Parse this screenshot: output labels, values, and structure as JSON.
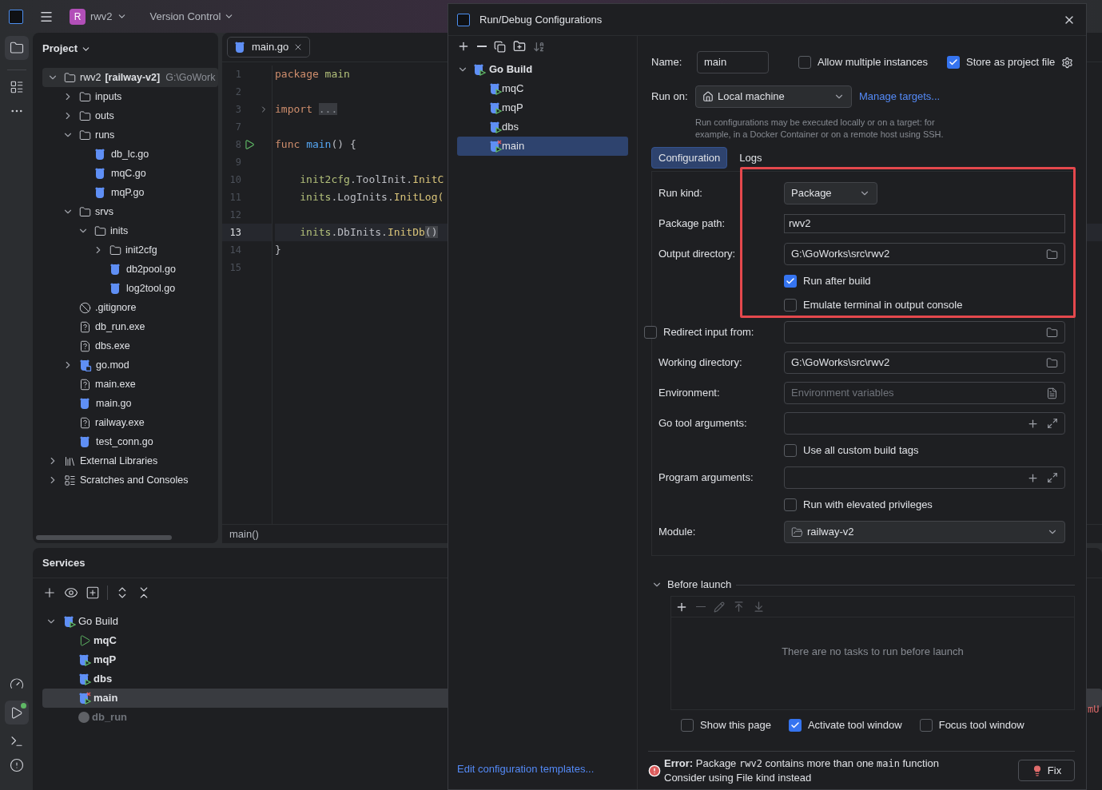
{
  "toolbar": {
    "project_badge": "R",
    "project": "rwv2",
    "vcs": "Version Control"
  },
  "project_panel": {
    "title": "Project",
    "tree": [
      {
        "label": "rwv2",
        "module": "[railway-v2]",
        "path": "G:\\GoWork",
        "kind": "folder",
        "expanded": true,
        "selected": true,
        "children": [
          {
            "label": "inputs",
            "kind": "folder",
            "expanded": false,
            "selected": false
          },
          {
            "label": "outs",
            "kind": "folder",
            "expanded": false,
            "selected": false
          },
          {
            "label": "runs",
            "kind": "folder",
            "expanded": true,
            "selected": false,
            "children": [
              {
                "label": "db_lc.go",
                "kind": "go",
                "selected": false
              },
              {
                "label": "mqC.go",
                "kind": "go",
                "selected": false
              },
              {
                "label": "mqP.go",
                "kind": "go",
                "selected": false
              }
            ]
          },
          {
            "label": "srvs",
            "kind": "folder",
            "expanded": true,
            "selected": false,
            "children": [
              {
                "label": "inits",
                "kind": "folder",
                "expanded": true,
                "selected": false,
                "children": [
                  {
                    "label": "init2cfg",
                    "kind": "folder",
                    "expanded": false,
                    "selected": false
                  },
                  {
                    "label": "db2pool.go",
                    "kind": "go",
                    "selected": false
                  },
                  {
                    "label": "log2tool.go",
                    "kind": "go",
                    "selected": false
                  }
                ]
              }
            ]
          },
          {
            "label": ".gitignore",
            "kind": "ignore",
            "selected": false
          },
          {
            "label": "db_run.exe",
            "kind": "unknown",
            "selected": false
          },
          {
            "label": "dbs.exe",
            "kind": "unknown",
            "selected": false
          },
          {
            "label": "go.mod",
            "kind": "gomod",
            "expanded": false,
            "selected": false
          },
          {
            "label": "main.exe",
            "kind": "unknown",
            "selected": false
          },
          {
            "label": "main.go",
            "kind": "go",
            "selected": false
          },
          {
            "label": "railway.exe",
            "kind": "unknown",
            "selected": false
          },
          {
            "label": "test_conn.go",
            "kind": "go",
            "selected": false
          }
        ]
      },
      {
        "label": "External Libraries",
        "kind": "libraries",
        "expanded": false,
        "selected": false
      },
      {
        "label": "Scratches and Consoles",
        "kind": "scratches",
        "expanded": false,
        "selected": false
      }
    ]
  },
  "editor": {
    "tab": "main.go",
    "breadcrumb": "main()",
    "lines": [
      {
        "number": "1",
        "current": false,
        "fold": false,
        "run": false,
        "indent": false,
        "tokens": [
          {
            "text": "package",
            "kind": "keyword"
          },
          {
            "text": "main",
            "kind": "pkg"
          }
        ]
      },
      {
        "number": "2",
        "current": false,
        "fold": false,
        "run": false
      },
      {
        "number": "3",
        "current": false,
        "fold": true,
        "run": false,
        "indent": false,
        "tokens": [
          {
            "text": "import",
            "kind": "keyword"
          },
          {
            "text": "...",
            "kind": "folded"
          }
        ]
      },
      {
        "number": "7",
        "current": false,
        "fold": false,
        "run": false
      },
      {
        "number": "8",
        "current": false,
        "fold": false,
        "run": true,
        "indent": false,
        "tokens": [
          {
            "text": "func",
            "kind": "keyword"
          },
          {
            "text": "main",
            "kind": "func"
          },
          {
            "text": "() {",
            "kind": "plain"
          }
        ]
      },
      {
        "number": "9",
        "current": false,
        "fold": false,
        "run": false
      },
      {
        "number": "10",
        "current": false,
        "fold": false,
        "run": false,
        "indent": true,
        "tokens": [
          {
            "text": "init2cfg",
            "kind": "pkg"
          },
          {
            "text": ".ToolInit.",
            "kind": "plain"
          },
          {
            "text": "InitC",
            "kind": "method"
          }
        ]
      },
      {
        "number": "11",
        "current": false,
        "fold": false,
        "run": false,
        "indent": true,
        "tokens": [
          {
            "text": "inits",
            "kind": "pkg"
          },
          {
            "text": ".LogInits.",
            "kind": "plain"
          },
          {
            "text": "InitLog(",
            "kind": "method"
          }
        ]
      },
      {
        "number": "12",
        "current": false,
        "fold": false,
        "run": false
      },
      {
        "number": "13",
        "current": true,
        "fold": false,
        "run": false,
        "indent": true,
        "tokens": [
          {
            "text": "inits",
            "kind": "pkg"
          },
          {
            "text": ".DbInits.",
            "kind": "plain"
          },
          {
            "text": "InitDb",
            "kind": "method"
          },
          {
            "text": "()",
            "kind": "match"
          }
        ]
      },
      {
        "number": "14",
        "current": false,
        "fold": false,
        "run": false,
        "indent": false,
        "tokens": [
          {
            "text": "}",
            "kind": "plain"
          }
        ]
      },
      {
        "number": "15",
        "current": false,
        "fold": false,
        "run": false
      }
    ],
    "behind_text": "mU"
  },
  "services": {
    "title": "Services",
    "tree": [
      {
        "label": "Go Build",
        "kind": "group",
        "expanded": true,
        "selected": false,
        "children": [
          {
            "label": "mqC",
            "kind": "running",
            "selected": false
          },
          {
            "label": "mqP",
            "kind": "config",
            "selected": false
          },
          {
            "label": "dbs",
            "kind": "config",
            "selected": false
          },
          {
            "label": "main",
            "kind": "error",
            "selected": true
          },
          {
            "label": "db_run",
            "kind": "stopped",
            "selected": false
          }
        ]
      }
    ]
  },
  "dialog": {
    "title": "Run/Debug Configurations",
    "tree": [
      {
        "label": "Go Build",
        "expanded": true,
        "children": [
          {
            "label": "mqC",
            "error": false,
            "selected": false
          },
          {
            "label": "mqP",
            "error": false,
            "selected": false
          },
          {
            "label": "dbs",
            "error": false,
            "selected": false
          },
          {
            "label": "main",
            "error": true,
            "selected": true
          }
        ]
      }
    ],
    "templates_link": "Edit configuration templates...",
    "name_label": "Name:",
    "name_value": "main",
    "allow_multiple": {
      "label": "Allow multiple instances",
      "checked": false
    },
    "store_project": {
      "label": "Store as project file",
      "checked": true
    },
    "run_on_label": "Run on:",
    "run_on_value": "Local machine",
    "manage_targets": "Manage targets...",
    "run_on_hint": "Run configurations may be executed locally or on a target: for example, in a Docker Container or on a remote host using SSH.",
    "tabs": [
      {
        "label": "Configuration",
        "selected": true
      },
      {
        "label": "Logs",
        "selected": false
      }
    ],
    "rows": [
      {
        "kind": "select",
        "label": "Run kind:",
        "value": "Package"
      },
      {
        "kind": "text",
        "label": "Package path:",
        "value": "rwv2"
      },
      {
        "kind": "path",
        "label": "Output directory:",
        "value": "G:\\GoWorks\\src\\rwv2"
      },
      {
        "kind": "check",
        "label": "Run after build",
        "checked": true
      },
      {
        "kind": "check",
        "label": "Emulate terminal in output console",
        "checked": false
      },
      {
        "kind": "check_path",
        "label": "Redirect input from:",
        "checked": false
      },
      {
        "kind": "path",
        "label": "Working directory:",
        "value": "G:\\GoWorks\\src\\rwv2"
      },
      {
        "kind": "env",
        "label": "Environment:",
        "placeholder": "Environment variables"
      },
      {
        "kind": "args",
        "label": "Go tool arguments:"
      },
      {
        "kind": "check",
        "label": "Use all custom build tags",
        "checked": false
      },
      {
        "kind": "args",
        "label": "Program arguments:"
      },
      {
        "kind": "check",
        "label": "Run with elevated privileges",
        "checked": false
      },
      {
        "kind": "module",
        "label": "Module:",
        "value": "railway-v2"
      }
    ],
    "before_launch": {
      "title": "Before launch",
      "expanded": true,
      "empty": "There are no tasks to run before launch",
      "options": [
        {
          "label": "Show this page",
          "checked": false
        },
        {
          "label": "Activate tool window",
          "checked": true
        },
        {
          "label": "Focus tool window",
          "checked": false
        }
      ]
    },
    "error": {
      "label": "Error:",
      "parts": [
        {
          "text": "Package ",
          "kind": "text"
        },
        {
          "text": "rwv2",
          "kind": "code"
        },
        {
          "text": " contains more than one ",
          "kind": "text"
        },
        {
          "text": "main",
          "kind": "code"
        },
        {
          "text": " function",
          "kind": "text"
        }
      ],
      "hint": "Consider using File kind instead"
    },
    "fix_button": "Fix"
  }
}
